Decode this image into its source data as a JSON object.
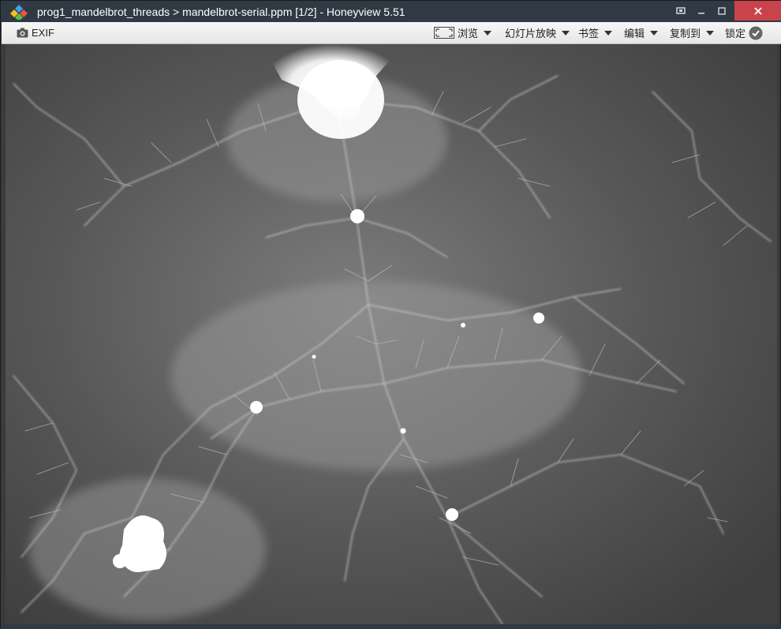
{
  "window": {
    "title": "prog1_mandelbrot_threads > mandelbrot-serial.ppm [1/2] - Honeyview 5.51",
    "app_icon": "honeyview-diamond-icon",
    "controls": {
      "pin_icon": "pin-window-icon",
      "minimize_icon": "minimize-icon",
      "maximize_icon": "maximize-icon",
      "close_icon": "close-icon"
    }
  },
  "toolbar": {
    "exif_label": "EXIF",
    "browse_label": "浏览",
    "slideshow_label": "幻灯片放映",
    "bookmark_label": "书签",
    "edit_label": "编辑",
    "copy_to_label": "复制到",
    "lock_label": "锁定"
  },
  "image": {
    "filename": "mandelbrot-serial.ppm",
    "description_type": "grayscale Mandelbrot fractal"
  },
  "colors": {
    "titlebar_bg": "#2f3a45",
    "close_red": "#c9444a",
    "toolbar_bg": "#ececec"
  }
}
